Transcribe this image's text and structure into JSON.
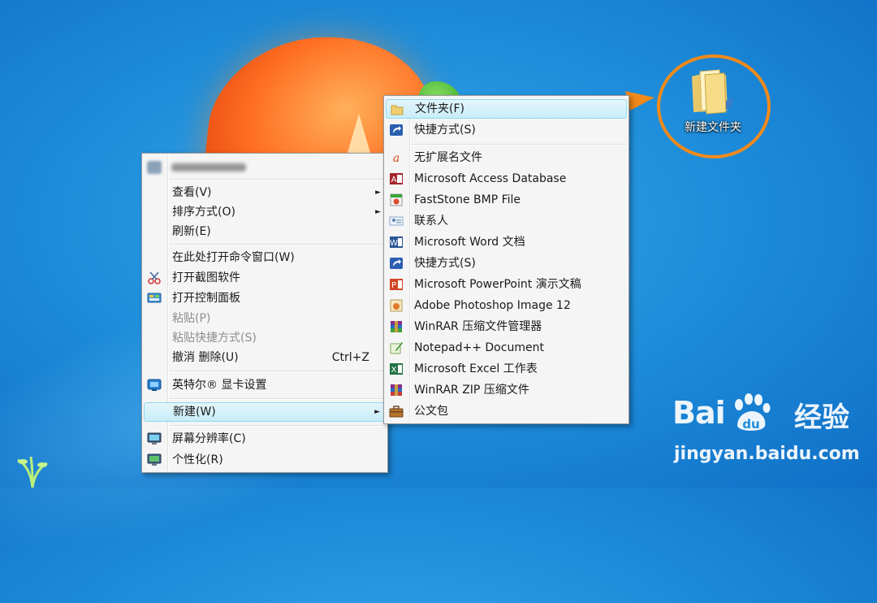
{
  "desktop": {
    "icon_label": "新建文件夹"
  },
  "context_menu": {
    "items": [
      {
        "label": "查看(V)",
        "submenu": true
      },
      {
        "label": "排序方式(O)",
        "submenu": true
      },
      {
        "label": "刷新(E)"
      },
      {
        "label": "在此处打开命令窗口(W)"
      },
      {
        "label": "打开截图软件"
      },
      {
        "label": "打开控制面板"
      },
      {
        "label": "粘贴(P)",
        "disabled": true
      },
      {
        "label": "粘贴快捷方式(S)",
        "disabled": true
      },
      {
        "label": "撤消 删除(U)",
        "shortcut": "Ctrl+Z"
      },
      {
        "label": "英特尔® 显卡设置"
      },
      {
        "label": "新建(W)",
        "submenu": true,
        "highlighted": true
      },
      {
        "label": "屏幕分辨率(C)"
      },
      {
        "label": "个性化(R)"
      }
    ],
    "submenu_arrow": "►"
  },
  "new_submenu": {
    "items": [
      {
        "label": "文件夹(F)",
        "icon": "folder-icon"
      },
      {
        "label": "快捷方式(S)",
        "icon": "shortcut-icon"
      },
      {
        "label": "无扩展名文件",
        "icon": "blank-file-icon"
      },
      {
        "label": "Microsoft Access Database",
        "icon": "access-icon"
      },
      {
        "label": "FastStone BMP File",
        "icon": "bmp-icon"
      },
      {
        "label": "联系人",
        "icon": "contact-icon"
      },
      {
        "label": "Microsoft Word 文档",
        "icon": "word-icon"
      },
      {
        "label": "快捷方式(S)",
        "icon": "shortcut-icon"
      },
      {
        "label": "Microsoft PowerPoint 演示文稿",
        "icon": "powerpoint-icon"
      },
      {
        "label": "Adobe Photoshop Image 12",
        "icon": "photoshop-icon"
      },
      {
        "label": "WinRAR 压缩文件管理器",
        "icon": "winrar-icon"
      },
      {
        "label": "Notepad++ Document",
        "icon": "notepadpp-icon"
      },
      {
        "label": "Microsoft Excel 工作表",
        "icon": "excel-icon"
      },
      {
        "label": "WinRAR ZIP 压缩文件",
        "icon": "winrar-zip-icon"
      },
      {
        "label": "公文包",
        "icon": "briefcase-icon"
      }
    ]
  },
  "watermark": {
    "brand": "Bai",
    "brand_paw": "du",
    "product": "经验",
    "url": "jingyan.baidu.com"
  },
  "colors": {
    "accent_orange": "#f28a1a",
    "highlight": "#c8edf9",
    "desktop_blue": "#1f8fdc"
  }
}
